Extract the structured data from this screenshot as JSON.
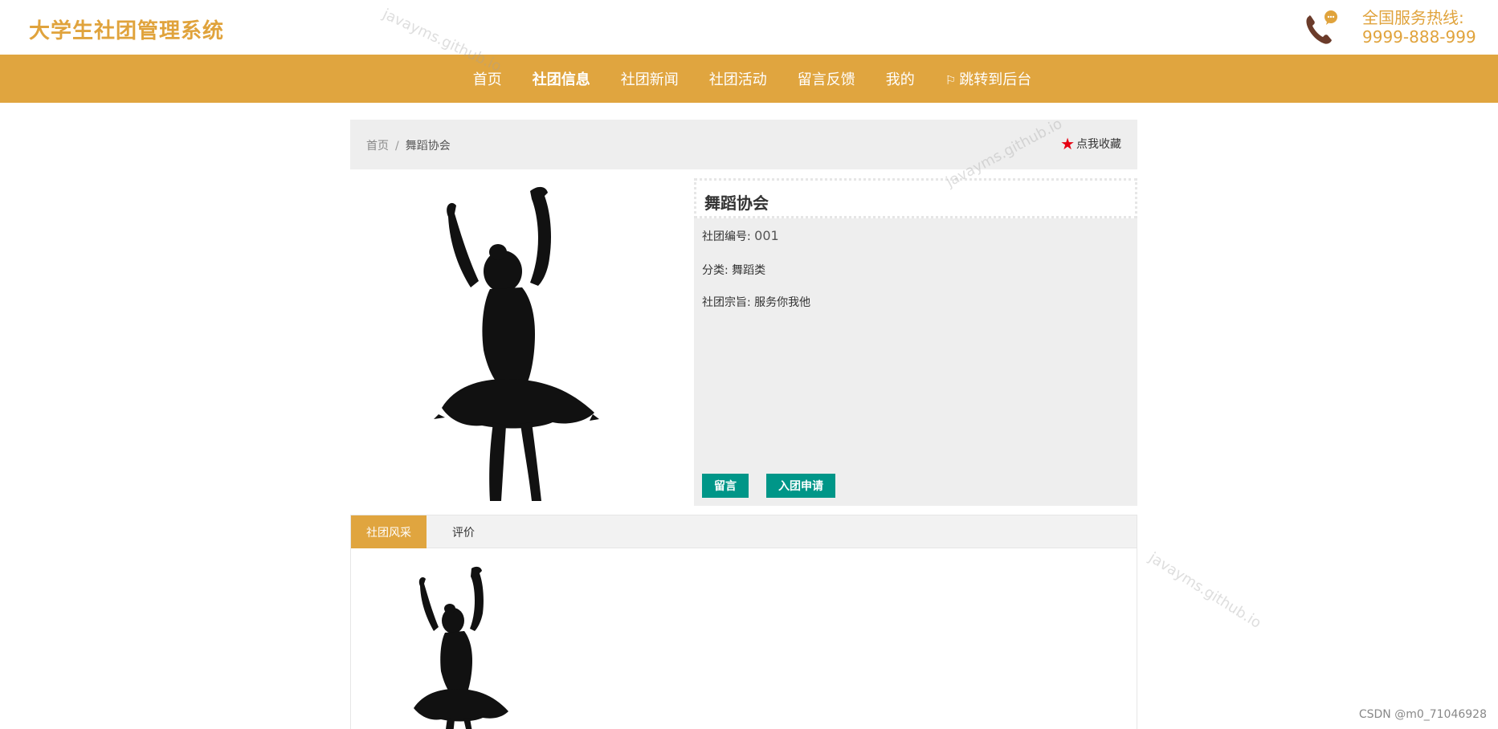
{
  "header": {
    "title": "大学生社团管理系统",
    "hotline_label": "全国服务热线:",
    "hotline_number": "9999-888-999"
  },
  "nav": {
    "items": [
      {
        "label": "首页"
      },
      {
        "label": "社团信息"
      },
      {
        "label": "社团新闻"
      },
      {
        "label": "社团活动"
      },
      {
        "label": "留言反馈"
      },
      {
        "label": "我的"
      },
      {
        "label": "跳转到后台"
      }
    ],
    "active_index": 1
  },
  "breadcrumb": {
    "home": "首页",
    "separator": "/",
    "current": "舞蹈协会"
  },
  "favorite_label": "点我收藏",
  "club": {
    "name": "舞蹈协会",
    "id_label": "社团编号:",
    "id_value": "001",
    "category_label": "分类:",
    "category_value": "舞蹈类",
    "purpose_label": "社团宗旨:",
    "purpose_value": "服务你我他"
  },
  "buttons": {
    "message": "留言",
    "join": "入团申请"
  },
  "tabs": [
    {
      "label": "社团风采"
    },
    {
      "label": "评价"
    }
  ],
  "watermark_text": "javayms.github.io",
  "footer_credit": "CSDN @m0_71046928",
  "colors": {
    "brand": "#e0a53f",
    "button": "#009688",
    "star": "#e60012"
  },
  "icons": [
    "phone-chat-icon",
    "flag-icon",
    "star-icon"
  ]
}
